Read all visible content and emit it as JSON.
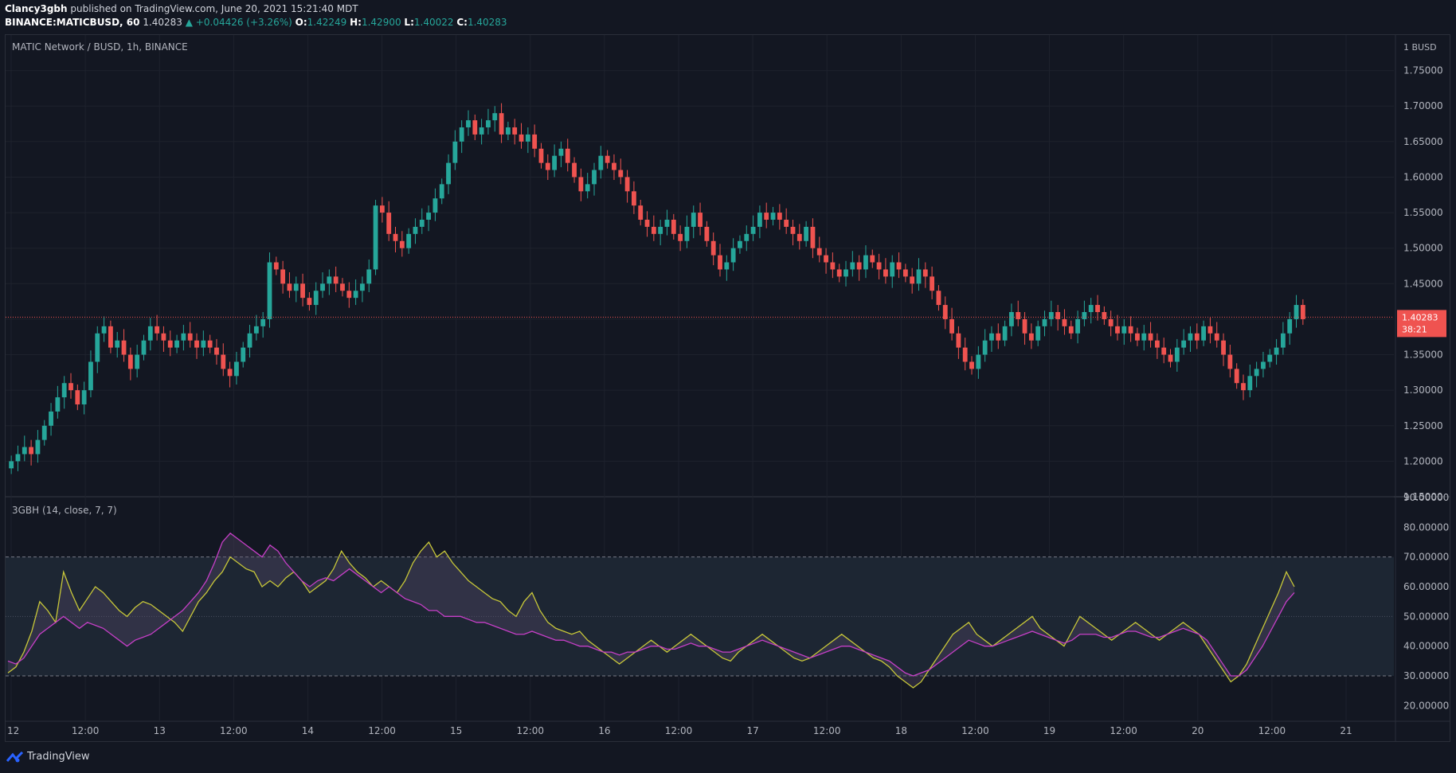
{
  "header": {
    "user": "Clancy3gbh",
    "published": " published on TradingView.com, June 20, 2021 15:21:40 MDT",
    "symbol": "BINANCE:MATICBUSD, 60",
    "last": "1.40283",
    "change": "▲ +0.04426 (+3.26%)",
    "o_label": "O:",
    "o": "1.42249",
    "h_label": "H:",
    "h": "1.42900",
    "l_label": "L:",
    "l": "1.40022",
    "c_label": "C:",
    "c": "1.40283"
  },
  "main_pane": {
    "title": "MATIC Network / BUSD, 1h, BINANCE",
    "currency": "BUSD",
    "price_label": "1.40283",
    "countdown": "38:21"
  },
  "indicator_pane": {
    "title": "3GBH (14, close, 7, 7)"
  },
  "footer": {
    "brand": "TradingView"
  },
  "colors": {
    "bg": "#131722",
    "up": "#26a69a",
    "down": "#ef5350",
    "yellow": "#c8c839",
    "magenta": "#c63fc7",
    "grid": "#1e222d"
  },
  "chart_data": [
    {
      "type": "candlestick",
      "series_name": "MATIC Network / BUSD",
      "ylim": [
        1.15,
        1.8
      ],
      "y_ticks": [
        "1.75000",
        "1.70000",
        "1.65000",
        "1.60000",
        "1.55000",
        "1.50000",
        "1.45000",
        "1.40000",
        "1.35000",
        "1.30000",
        "1.25000",
        "1.20000",
        "1.15000"
      ],
      "y_tick_values": [
        1.75,
        1.7,
        1.65,
        1.6,
        1.55,
        1.5,
        1.45,
        1.4,
        1.35,
        1.3,
        1.25,
        1.2,
        1.15
      ],
      "x_labels": [
        "12",
        "12:00",
        "13",
        "12:00",
        "14",
        "12:00",
        "15",
        "12:00",
        "16",
        "12:00",
        "17",
        "12:00",
        "18",
        "12:00",
        "19",
        "12:00",
        "20",
        "12:00",
        "21"
      ],
      "closes": [
        1.2,
        1.21,
        1.22,
        1.21,
        1.23,
        1.25,
        1.27,
        1.29,
        1.31,
        1.3,
        1.28,
        1.3,
        1.34,
        1.38,
        1.39,
        1.36,
        1.37,
        1.35,
        1.33,
        1.35,
        1.37,
        1.39,
        1.38,
        1.37,
        1.36,
        1.37,
        1.38,
        1.37,
        1.36,
        1.37,
        1.36,
        1.35,
        1.33,
        1.32,
        1.34,
        1.36,
        1.38,
        1.39,
        1.4,
        1.48,
        1.47,
        1.45,
        1.44,
        1.45,
        1.43,
        1.42,
        1.44,
        1.45,
        1.46,
        1.45,
        1.44,
        1.43,
        1.44,
        1.45,
        1.47,
        1.56,
        1.55,
        1.52,
        1.51,
        1.5,
        1.52,
        1.53,
        1.54,
        1.55,
        1.57,
        1.59,
        1.62,
        1.65,
        1.67,
        1.68,
        1.66,
        1.67,
        1.68,
        1.69,
        1.66,
        1.67,
        1.66,
        1.65,
        1.66,
        1.64,
        1.62,
        1.61,
        1.63,
        1.64,
        1.62,
        1.6,
        1.58,
        1.59,
        1.61,
        1.63,
        1.62,
        1.61,
        1.6,
        1.58,
        1.56,
        1.54,
        1.53,
        1.52,
        1.53,
        1.54,
        1.52,
        1.51,
        1.53,
        1.55,
        1.53,
        1.51,
        1.49,
        1.47,
        1.48,
        1.5,
        1.51,
        1.52,
        1.53,
        1.55,
        1.54,
        1.55,
        1.54,
        1.53,
        1.52,
        1.51,
        1.53,
        1.5,
        1.49,
        1.48,
        1.47,
        1.46,
        1.47,
        1.48,
        1.47,
        1.49,
        1.48,
        1.47,
        1.46,
        1.48,
        1.47,
        1.46,
        1.45,
        1.47,
        1.46,
        1.44,
        1.42,
        1.4,
        1.38,
        1.36,
        1.34,
        1.33,
        1.35,
        1.37,
        1.38,
        1.37,
        1.39,
        1.41,
        1.4,
        1.38,
        1.37,
        1.39,
        1.4,
        1.41,
        1.4,
        1.39,
        1.38,
        1.4,
        1.41,
        1.42,
        1.41,
        1.4,
        1.39,
        1.38,
        1.39,
        1.38,
        1.37,
        1.38,
        1.37,
        1.36,
        1.35,
        1.34,
        1.36,
        1.37,
        1.38,
        1.37,
        1.39,
        1.38,
        1.37,
        1.35,
        1.33,
        1.31,
        1.3,
        1.32,
        1.33,
        1.34,
        1.35,
        1.36,
        1.38,
        1.4,
        1.42,
        1.4
      ]
    },
    {
      "type": "line",
      "series_name": "3GBH (14, close, 7, 7)",
      "ylim": [
        15,
        90
      ],
      "y_ticks": [
        "90.00000",
        "80.00000",
        "70.00000",
        "60.00000",
        "50.00000",
        "40.00000",
        "30.00000",
        "20.00000"
      ],
      "y_tick_values": [
        90,
        80,
        70,
        60,
        50,
        40,
        30,
        20
      ],
      "levels": [
        70,
        50,
        30
      ],
      "yellow": [
        31,
        33,
        38,
        45,
        55,
        52,
        48,
        65,
        58,
        52,
        56,
        60,
        58,
        55,
        52,
        50,
        53,
        55,
        54,
        52,
        50,
        48,
        45,
        50,
        55,
        58,
        62,
        65,
        70,
        68,
        66,
        65,
        60,
        62,
        60,
        63,
        65,
        62,
        58,
        60,
        62,
        66,
        72,
        68,
        65,
        63,
        60,
        62,
        60,
        58,
        62,
        68,
        72,
        75,
        70,
        72,
        68,
        65,
        62,
        60,
        58,
        56,
        55,
        52,
        50,
        55,
        58,
        52,
        48,
        46,
        45,
        44,
        45,
        42,
        40,
        38,
        36,
        34,
        36,
        38,
        40,
        42,
        40,
        38,
        40,
        42,
        44,
        42,
        40,
        38,
        36,
        35,
        38,
        40,
        42,
        44,
        42,
        40,
        38,
        36,
        35,
        36,
        38,
        40,
        42,
        44,
        42,
        40,
        38,
        36,
        35,
        33,
        30,
        28,
        26,
        28,
        32,
        36,
        40,
        44,
        46,
        48,
        44,
        42,
        40,
        42,
        44,
        46,
        48,
        50,
        46,
        44,
        42,
        40,
        45,
        50,
        48,
        46,
        44,
        42,
        44,
        46,
        48,
        46,
        44,
        42,
        44,
        46,
        48,
        46,
        44,
        40,
        36,
        32,
        28,
        30,
        34,
        40,
        46,
        52,
        58,
        65,
        60
      ],
      "magenta": [
        35,
        34,
        36,
        40,
        44,
        46,
        48,
        50,
        48,
        46,
        48,
        47,
        46,
        44,
        42,
        40,
        42,
        43,
        44,
        46,
        48,
        50,
        52,
        55,
        58,
        62,
        68,
        75,
        78,
        76,
        74,
        72,
        70,
        74,
        72,
        68,
        65,
        62,
        60,
        62,
        63,
        62,
        64,
        66,
        64,
        62,
        60,
        58,
        60,
        58,
        56,
        55,
        54,
        52,
        52,
        50,
        50,
        50,
        49,
        48,
        48,
        47,
        46,
        45,
        44,
        44,
        45,
        44,
        43,
        42,
        42,
        41,
        40,
        40,
        39,
        38,
        38,
        37,
        38,
        38,
        39,
        40,
        40,
        39,
        39,
        40,
        41,
        40,
        40,
        39,
        38,
        38,
        39,
        40,
        41,
        42,
        41,
        40,
        39,
        38,
        37,
        36,
        37,
        38,
        39,
        40,
        40,
        39,
        38,
        37,
        36,
        35,
        33,
        31,
        30,
        31,
        32,
        34,
        36,
        38,
        40,
        42,
        41,
        40,
        40,
        41,
        42,
        43,
        44,
        45,
        44,
        43,
        42,
        41,
        42,
        44,
        44,
        44,
        43,
        43,
        44,
        45,
        45,
        44,
        43,
        43,
        44,
        45,
        46,
        45,
        44,
        42,
        38,
        34,
        30,
        30,
        32,
        36,
        40,
        45,
        50,
        55,
        58
      ]
    }
  ]
}
